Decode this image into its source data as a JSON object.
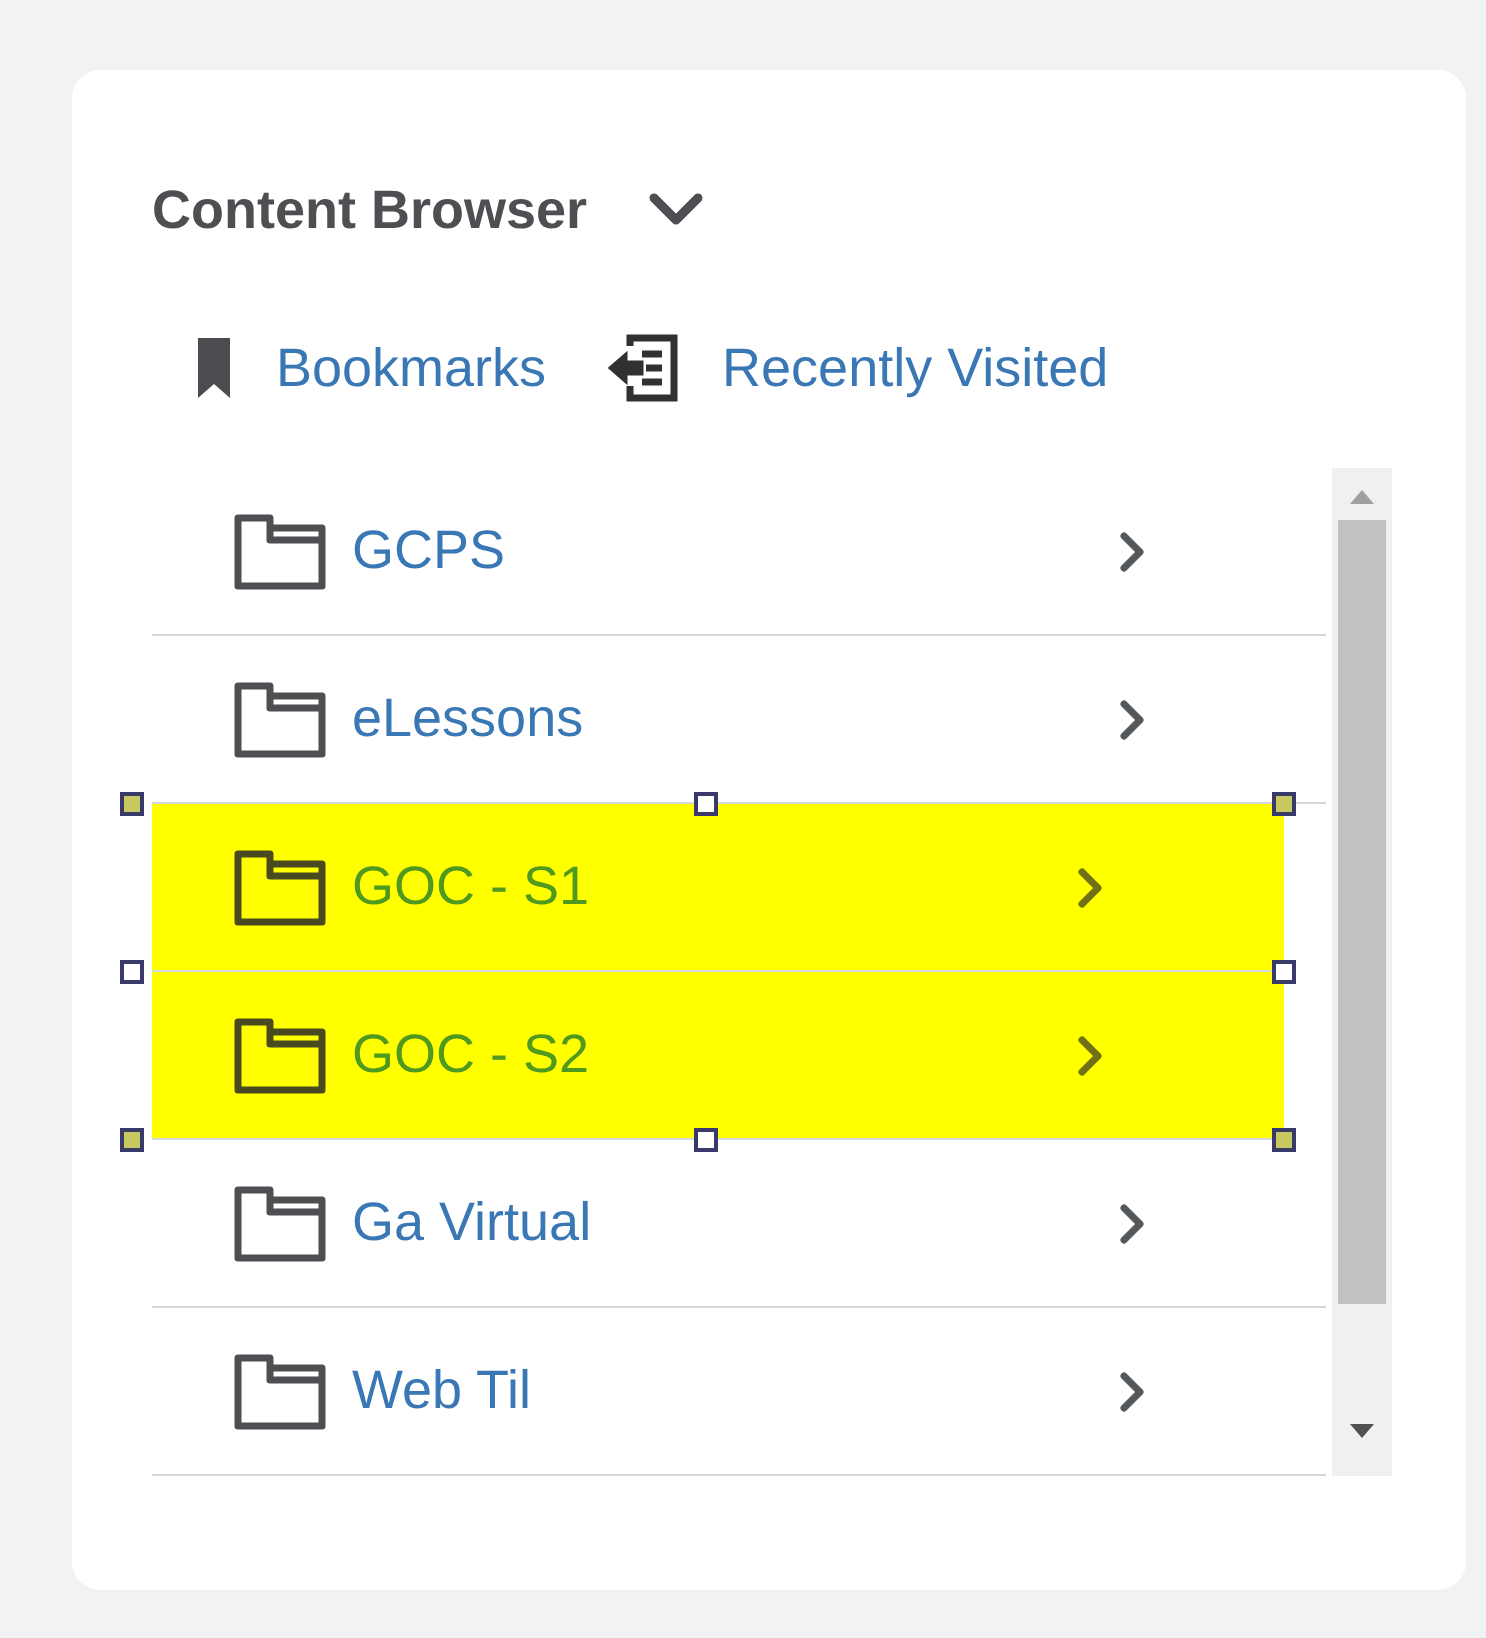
{
  "panel": {
    "title": "Content Browser",
    "expanded": true
  },
  "links": [
    {
      "kind": "bookmark",
      "label": "Bookmarks"
    },
    {
      "kind": "recent",
      "label": "Recently Visited"
    }
  ],
  "folders": [
    {
      "name": "GCPS",
      "highlighted": false
    },
    {
      "name": "eLessons",
      "highlighted": false
    },
    {
      "name": "GOC - S1",
      "highlighted": true
    },
    {
      "name": "GOC - S2",
      "highlighted": true
    },
    {
      "name": "Ga Virtual",
      "highlighted": false
    },
    {
      "name": "Web Til",
      "highlighted": false
    }
  ]
}
